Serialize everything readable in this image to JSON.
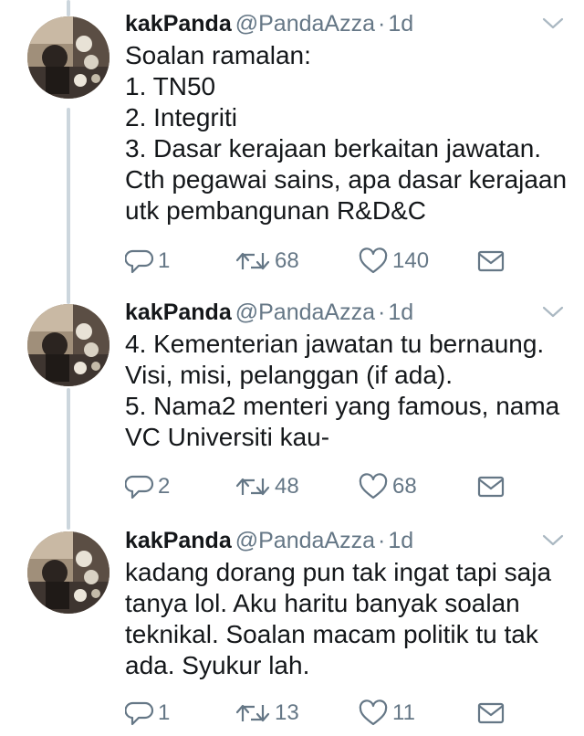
{
  "tweets": [
    {
      "name": "kakPanda",
      "handle": "@PandaAzza",
      "separator": "·",
      "time": "1d",
      "lines": [
        "Soalan ramalan:",
        "1. TN50",
        "2. Integriti",
        "3. Dasar kerajaan berkaitan jawatan.",
        "Cth pegawai sains, apa dasar kerajaan",
        "utk pembangunan R&D&C"
      ],
      "replies": "1",
      "retweets": "68",
      "likes": "140"
    },
    {
      "name": "kakPanda",
      "handle": "@PandaAzza",
      "separator": "·",
      "time": "1d",
      "lines": [
        "4. Kementerian jawatan tu bernaung.",
        "Visi, misi, pelanggan (if ada).",
        "5. Nama2 menteri yang famous, nama",
        "VC Universiti kau-"
      ],
      "replies": "2",
      "retweets": "48",
      "likes": "68"
    },
    {
      "name": "kakPanda",
      "handle": "@PandaAzza",
      "separator": "·",
      "time": "1d",
      "lines": [
        "kadang dorang pun tak ingat tapi saja",
        "tanya lol. Aku haritu banyak soalan",
        "teknikal. Soalan macam politik tu tak",
        "ada. Syukur lah."
      ],
      "replies": "1",
      "retweets": "13",
      "likes": "11"
    }
  ],
  "icons": {
    "reply": "reply-icon",
    "retweet": "retweet-icon",
    "like": "heart-icon",
    "dm": "message-icon",
    "more": "chevron-down-icon"
  },
  "colors": {
    "text": "#14171a",
    "muted": "#657786",
    "thread_line": "#ccd6dd"
  }
}
